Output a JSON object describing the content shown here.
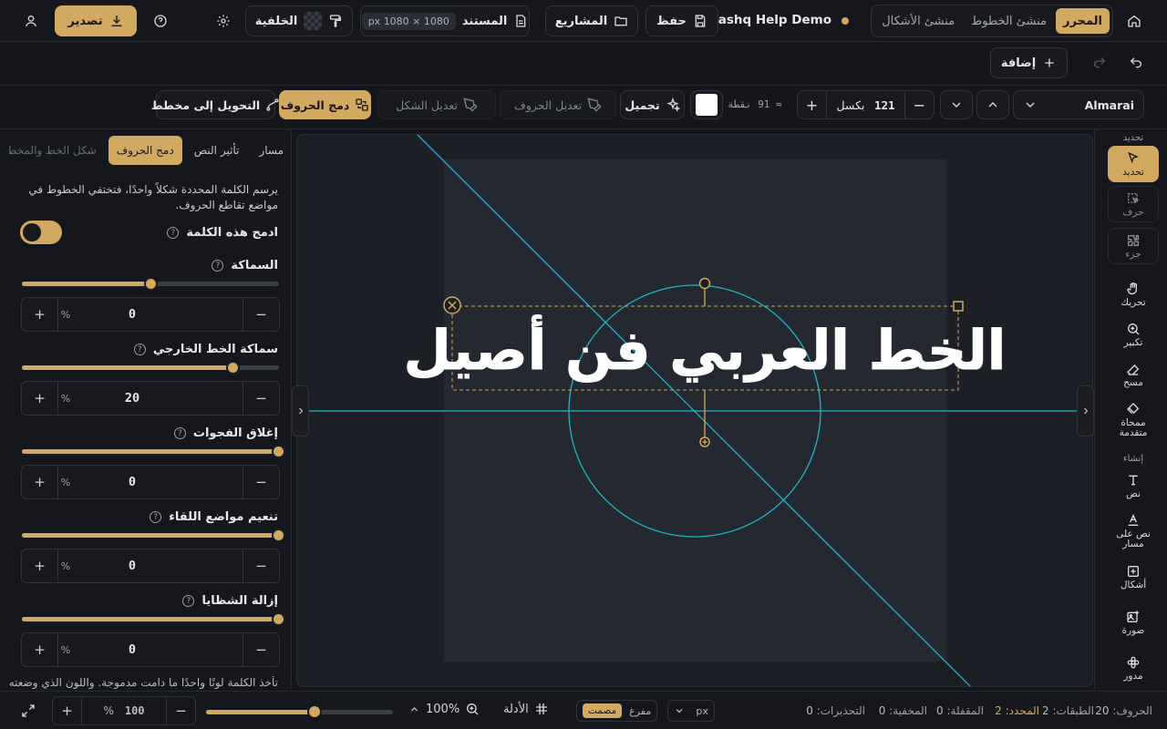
{
  "topbar": {
    "modes": [
      "المحرر",
      "منشئ الخطوط",
      "منشئ الأشكال"
    ],
    "project_title": "Mashq Help Demo",
    "save_label": "حفظ",
    "projects_label": "المشاريع",
    "document_label": "المستند",
    "document_size": "1080 × 1080 px",
    "background_label": "الخلفية",
    "export_label": "تصدير"
  },
  "row2": {
    "add_label": "إضافة"
  },
  "toolbar": {
    "font": "Almarai",
    "size_value": "121",
    "size_unit": "بكسل",
    "pt_hint": "≈ 91 نقطة",
    "color": "#ffffff",
    "beautify_label": "تجميل",
    "edit_glyphs_label": "تعديل الحروف",
    "edit_shape_label": "تعديل الشكل",
    "merge_label": "دمج الحروف",
    "convert_label": "التحويل إلى مخطط"
  },
  "right_tools": {
    "select_header": "تحديد",
    "select": "تحديد",
    "glyph": "حرف",
    "part": "جزء",
    "pan": "تحريك",
    "zoom": "تكبير",
    "erase": "مسح",
    "advanced_eraser": "ممحاة متقدمة",
    "create_header": "إنشاء",
    "text": "نص",
    "text_on_path": "نص على مسار",
    "shapes": "أشكال",
    "image": "صورة",
    "rosette": "مدور"
  },
  "canvas": {
    "text": "الخط العربي فن أصيل"
  },
  "panel": {
    "tabs": [
      "مسار",
      "تأثير النص",
      "دمج الحروف",
      "شكل الخط والمخطط"
    ],
    "active_tab": "دمج الحروف",
    "description": "يرسم الكلمة المحددة شكلاً واحدًا، فتختفي الخطوط في مواضع تقاطع الحروف.",
    "merge_word_label": "ادمج هذه الكلمة",
    "merge_word_on": true,
    "controls": [
      {
        "label": "السماكة",
        "value": "0",
        "unit": "%",
        "position": 0.5
      },
      {
        "label": "سماكة الخط الخارجي",
        "value": "20",
        "unit": "%",
        "position": 0.82
      },
      {
        "label": "إغلاق الفجوات",
        "value": "0",
        "unit": "%",
        "position": 1.0
      },
      {
        "label": "تنعيم مواضع اللقاء",
        "value": "0",
        "unit": "%",
        "position": 1.0
      },
      {
        "label": "إزالة الشظايا",
        "value": "0",
        "unit": "%",
        "position": 1.0
      }
    ],
    "footer_note": "تأخذ الكلمة لونًا واحدًا ما دامت مدموجة. واللون الذي وضعته"
  },
  "status": {
    "letters_label": "الحروف:",
    "letters": "20",
    "layers_label": "الطبقات:",
    "layers": "2",
    "selected_label": "المحدد:",
    "selected": "2",
    "locked_label": "المقفلة:",
    "locked": "0",
    "hidden_label": "المخفية:",
    "hidden": "0",
    "warnings_label": "التحذيرات:",
    "warnings": "0",
    "unit": "px",
    "snap_hollow": "مفرغ",
    "snap_solid": "مصمت",
    "guides_label": "الأدلة",
    "zoom": "100%",
    "zoom_value": "100",
    "zoom_unit": "%"
  },
  "colors": {
    "accent": "#d2a960",
    "guide": "#1fb6c8",
    "bg": "#14161b"
  }
}
